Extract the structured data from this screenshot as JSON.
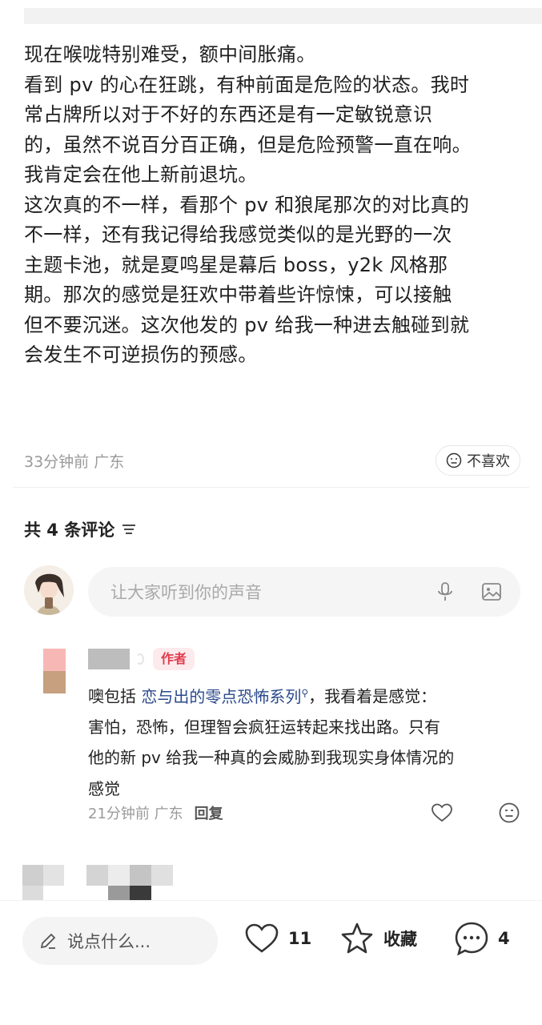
{
  "post": {
    "lines": [
      "现在喉咙特别难受，额中间胀痛。",
      "看到 pv 的心在狂跳，有种前面是危险的状态。我时",
      "常占牌所以对于不好的东西还是有一定敏锐意识",
      "的，虽然不说百分百正确，但是危险预警一直在响。",
      "我肯定会在他上新前退坑。",
      "这次真的不一样，看那个 pv 和狼尾那次的对比真的",
      "不一样，还有我记得给我感觉类似的是光野的一次",
      "主题卡池，就是夏鸣星是幕后 boss，y2k 风格那",
      "期。那次的感觉是狂欢中带着些许惊悚，可以接触",
      "但不要沉迷。这次他发的 pv 给我一种进去触碰到就",
      "会发生不可逆损伤的预感。"
    ],
    "time_location": "33分钟前 广东",
    "dislike_label": "不喜欢"
  },
  "comments": {
    "header": "共 4 条评论",
    "input_placeholder": "让大家听到你的声音",
    "first": {
      "author_tag": "作者",
      "line1_prefix": "噢包括 ",
      "line1_link": "恋与出的零点恐怖系列",
      "line1_suffix": "，我看着是感觉：",
      "line2": "害怕，恐怖，但理智会疯狂运转起来找出路。只有",
      "line3": "他的新 pv 给我一种真的会威胁到我现实身体情况的",
      "line4": "感觉",
      "time_location": "21分钟前 广东",
      "reply_label": "回复"
    }
  },
  "bottom_bar": {
    "say_placeholder": "说点什么...",
    "likes": "11",
    "collect_label": "收藏",
    "comments_count": "4"
  }
}
